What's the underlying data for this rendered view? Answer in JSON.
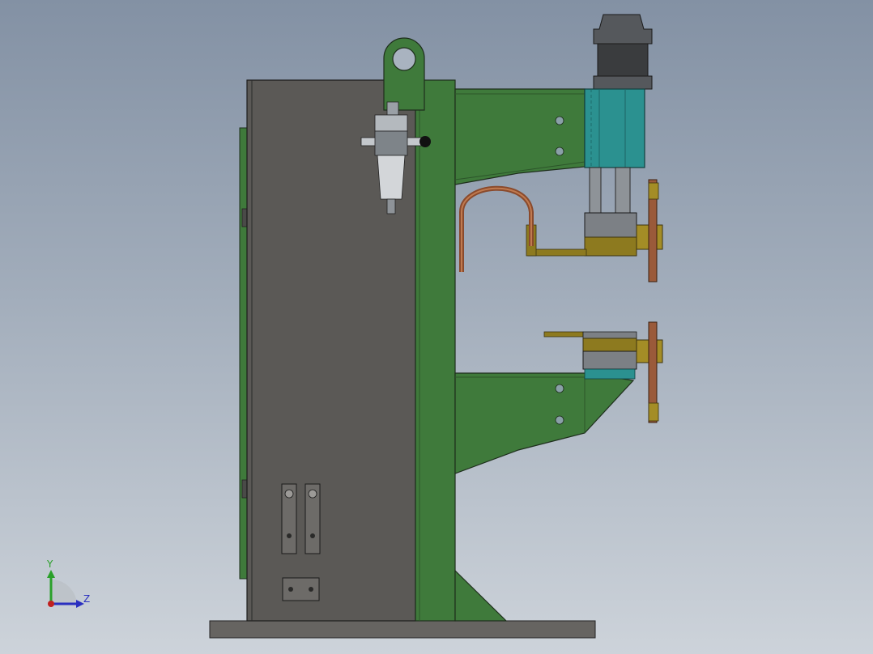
{
  "viewport": {
    "background_top": "#8391a4",
    "background_bottom": "#cdd3da"
  },
  "model": {
    "frame_color": "#3f7a3b",
    "cabinet_color": "#5b5956",
    "base_color": "#666461",
    "cylinder_color": "#2b9190",
    "brass_color": "#8d7a1f",
    "copper_color": "#9a5a3a"
  },
  "triad": {
    "y_label": "Y",
    "z_label": "Z",
    "y_color": "#2aa02a",
    "z_color": "#2a2fc0",
    "x_color": "#c02020"
  }
}
